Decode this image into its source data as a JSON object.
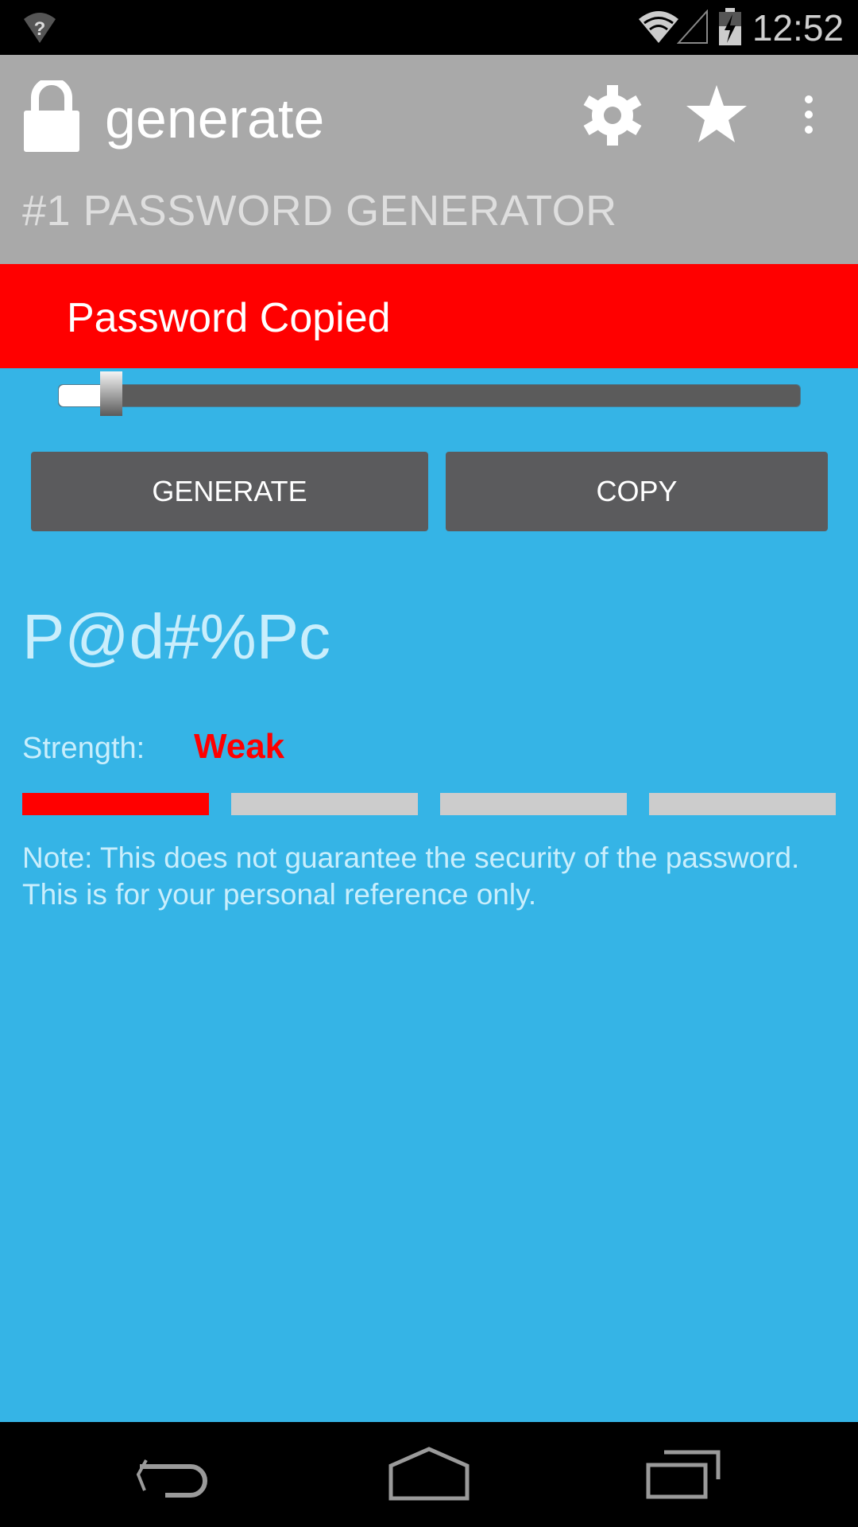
{
  "status_bar": {
    "time": "12:52",
    "icons": [
      "wifi-unknown-icon",
      "wifi-icon",
      "cell-signal-icon",
      "battery-charging-icon"
    ]
  },
  "action_bar": {
    "title": "generate",
    "subtitle": "#1 PASSWORD GENERATOR",
    "icons": [
      "lock-icon",
      "settings-icon",
      "star-icon",
      "overflow-menu-icon"
    ]
  },
  "banner": {
    "text": "Password Copied",
    "color": "#ff0000"
  },
  "length_slider": {
    "value_fraction": 0.06
  },
  "buttons": {
    "generate_label": "GENERATE",
    "copy_label": "COPY"
  },
  "password": {
    "value": "P@d#%Pc"
  },
  "strength": {
    "label": "Strength:",
    "value": "Weak",
    "value_color": "#ff0000",
    "segments_filled": 1,
    "segments_total": 4,
    "filled_color": "#ff0000",
    "empty_color": "#cccccc"
  },
  "note": "Note: This does not guarantee the security of the password. This is for your personal reference only.",
  "nav_bar": {
    "buttons": [
      "back",
      "home",
      "recents"
    ]
  },
  "colors": {
    "background": "#35b4e6",
    "action_bar": "#a9a9a9",
    "button": "#5b5b5d"
  }
}
